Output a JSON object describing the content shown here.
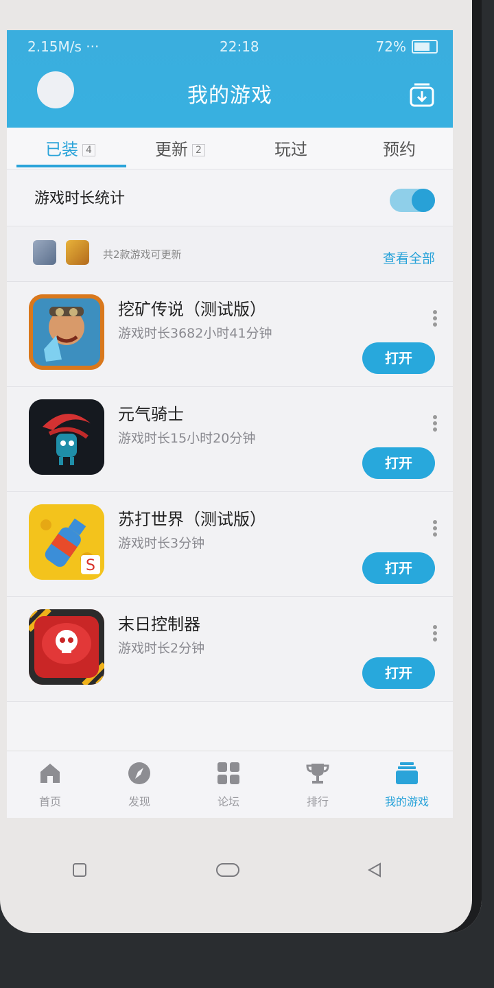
{
  "status_bar": {
    "left": "2.15M/s ···",
    "time": "22:18",
    "battery": "72%"
  },
  "header": {
    "title": "我的游戏"
  },
  "tabs": [
    {
      "label": "已装",
      "badge": "4"
    },
    {
      "label": "更新",
      "badge": "2"
    },
    {
      "label": "玩过",
      "badge": ""
    },
    {
      "label": "预约",
      "badge": ""
    }
  ],
  "stats": {
    "label": "游戏时长统计",
    "toggle_on": true
  },
  "updates": {
    "text": "共2款游戏可更新",
    "view_all": "查看全部"
  },
  "games": [
    {
      "name": "挖矿传说（测试版）",
      "time": "游戏时长3682小时41分钟",
      "button": "打开",
      "icon": "miner-game-icon"
    },
    {
      "name": "元气骑士",
      "time": "游戏时长15小时20分钟",
      "button": "打开",
      "icon": "soul-knight-icon"
    },
    {
      "name": "苏打世界（测试版）",
      "time": "游戏时长3分钟",
      "button": "打开",
      "icon": "soda-world-icon"
    },
    {
      "name": "末日控制器",
      "time": "游戏时长2分钟",
      "button": "打开",
      "icon": "skull-button-icon"
    }
  ],
  "bottom_nav": [
    {
      "label": "首页",
      "icon": "home-icon"
    },
    {
      "label": "发现",
      "icon": "compass-icon"
    },
    {
      "label": "论坛",
      "icon": "grid-icon"
    },
    {
      "label": "排行",
      "icon": "trophy-icon"
    },
    {
      "label": "我的游戏",
      "icon": "my-games-icon"
    }
  ],
  "colors": {
    "accent": "#2aa3d9",
    "header": "#38b0e0"
  }
}
